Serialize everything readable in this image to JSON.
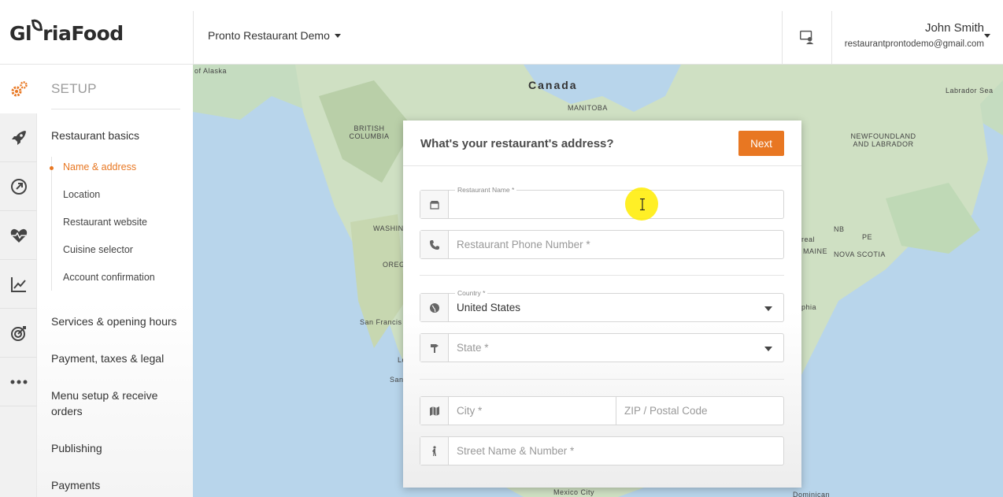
{
  "brand": {
    "logo_text_1": "Gl",
    "logo_text_2": "riaFood",
    "accent": "#e87722"
  },
  "header": {
    "restaurant_name": "Pronto Restaurant Demo",
    "user_name": "John Smith",
    "user_email": "restaurantprontodemo@gmail.com"
  },
  "icon_nav": [
    "gears-icon",
    "rocket-icon",
    "compass-icon",
    "heart-pulse-icon",
    "chart-icon",
    "target-icon",
    "more-icon"
  ],
  "sidebar": {
    "section_title": "SETUP",
    "groups": [
      {
        "label": "Restaurant basics"
      },
      {
        "label": "Services & opening hours"
      },
      {
        "label": "Payment, taxes & legal"
      },
      {
        "label": "Menu setup & receive orders"
      },
      {
        "label": "Publishing"
      },
      {
        "label": "Payments"
      }
    ],
    "subitems": [
      {
        "label": "Name & address",
        "active": true
      },
      {
        "label": "Location"
      },
      {
        "label": "Restaurant website"
      },
      {
        "label": "Cuisine selector"
      },
      {
        "label": "Account confirmation"
      }
    ]
  },
  "map": {
    "labels": [
      "of Alaska",
      "Canada",
      "MANITOBA",
      "BRITISH COLUMBIA",
      "Labrador Sea",
      "NEWFOUNDLAND AND LABRADOR",
      "WASHIN",
      "OREG",
      "San Francis",
      "Los",
      "San",
      "NB",
      "PE",
      "MAINE",
      "NOVA SCOTIA",
      "real",
      "phia",
      "Mexico City",
      "Dominican"
    ]
  },
  "dialog": {
    "title": "What's your restaurant's address?",
    "next_label": "Next",
    "name_label": "Restaurant Name *",
    "name_value": "",
    "phone_placeholder": "Restaurant Phone Number *",
    "country_label": "Country *",
    "country_value": "United States",
    "state_placeholder": "State *",
    "city_placeholder": "City *",
    "zip_placeholder": "ZIP / Postal Code",
    "street_placeholder": "Street Name & Number *"
  }
}
